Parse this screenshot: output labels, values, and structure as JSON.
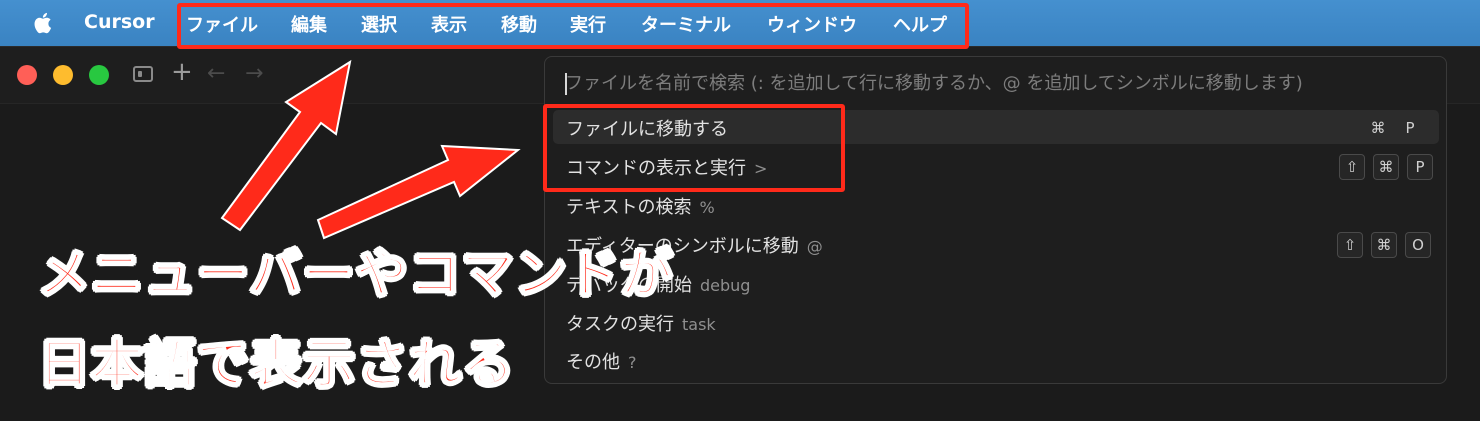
{
  "menubar": {
    "app_name": "Cursor",
    "items": [
      "ファイル",
      "編集",
      "選択",
      "表示",
      "移動",
      "実行",
      "ターミナル",
      "ウィンドウ",
      "ヘルプ"
    ]
  },
  "palette": {
    "placeholder": "ファイルを名前で検索 (: を追加して行に移動するか、@ を追加してシンボルに移動します)",
    "rows": [
      {
        "label": "ファイルに移動する",
        "prefix": "",
        "keys": [
          "⌘",
          "P"
        ]
      },
      {
        "label": "コマンドの表示と実行",
        "prefix": ">",
        "keys": [
          "⇧",
          "⌘",
          "P"
        ]
      },
      {
        "label": "テキストの検索",
        "prefix": "%",
        "keys": []
      },
      {
        "label": "エディターのシンボルに移動",
        "prefix": "@",
        "keys": [
          "⇧",
          "⌘",
          "O"
        ]
      },
      {
        "label": "デバッグの開始",
        "prefix": "debug",
        "keys": []
      },
      {
        "label": "タスクの実行",
        "prefix": "task",
        "keys": []
      },
      {
        "label": "その他",
        "prefix": "?",
        "keys": []
      }
    ]
  },
  "annotation": {
    "line1": "メニューバーやコマンドが",
    "line2": "日本語で表示される"
  },
  "colors": {
    "menubar": "#3e8ac9",
    "highlight": "#ff2a1a"
  }
}
